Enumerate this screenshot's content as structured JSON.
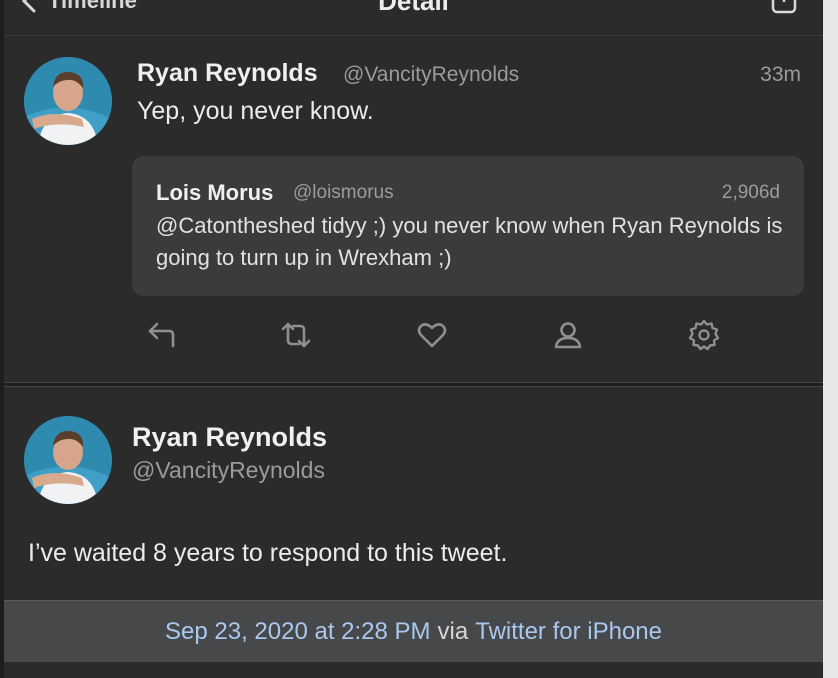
{
  "toolbar": {
    "back_label": "Timeline",
    "title": "Detail",
    "action_icon": "share-icon"
  },
  "tweet": {
    "name": "Ryan Reynolds",
    "handle": "@VancityReynolds",
    "time": "33m",
    "text": "Yep, you never know.",
    "quote": {
      "name": "Lois Morus",
      "handle": "@loismorus",
      "time": "2,906d",
      "text": "@Catontheshed tidyy ;) you never know when Ryan Reynolds is going to turn up in Wrexham ;)"
    },
    "actions": [
      "reply-icon",
      "retweet-icon",
      "like-icon",
      "profile-icon",
      "gear-icon"
    ]
  },
  "detail": {
    "name": "Ryan Reynolds",
    "handle": "@VancityReynolds",
    "text": "I’ve waited 8 years to respond to this tweet.",
    "date": "Sep 23, 2020 at 2:28 PM",
    "via": "via",
    "client": "Twitter for iPhone"
  },
  "colors": {
    "background": "#2b2b2c",
    "quote_bg": "#3b3b3d",
    "link": "#a9c8ef",
    "footer_bg": "#474849"
  }
}
